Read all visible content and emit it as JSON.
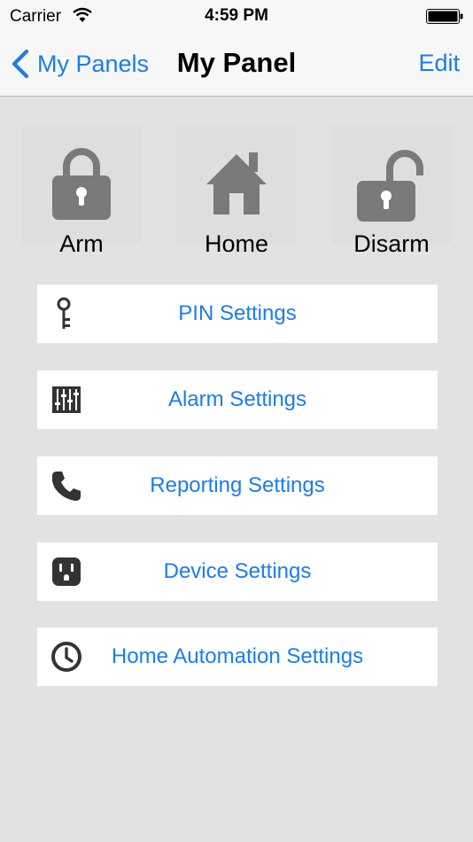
{
  "status_bar": {
    "carrier": "Carrier",
    "time": "4:59 PM"
  },
  "nav": {
    "back_label": "My Panels",
    "title": "My Panel",
    "edit_label": "Edit"
  },
  "modes": [
    {
      "label": "Arm",
      "icon": "locked-padlock-icon"
    },
    {
      "label": "Home",
      "icon": "house-icon"
    },
    {
      "label": "Disarm",
      "icon": "unlocked-padlock-icon"
    }
  ],
  "settings": [
    {
      "label": "PIN Settings",
      "icon": "key-icon"
    },
    {
      "label": "Alarm Settings",
      "icon": "sliders-icon"
    },
    {
      "label": "Reporting Settings",
      "icon": "phone-icon"
    },
    {
      "label": "Device Settings",
      "icon": "outlet-icon"
    },
    {
      "label": "Home Automation Settings",
      "icon": "clock-icon"
    }
  ],
  "colors": {
    "accent": "#1a7cf3",
    "background": "#e2e2e2",
    "icon_gray": "#7a7a7a"
  }
}
